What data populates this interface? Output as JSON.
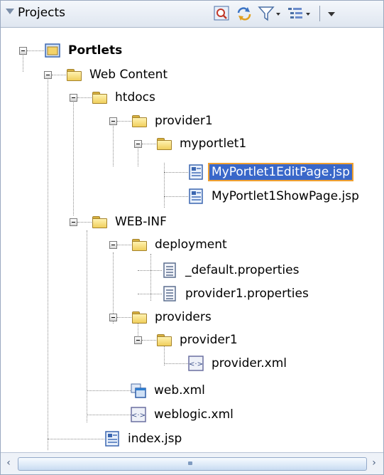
{
  "panel": {
    "title": "Projects"
  },
  "toolbar": {
    "icons": [
      "find-icon",
      "sync-icon",
      "filter-icon",
      "view-options-icon",
      "menu-icon"
    ]
  },
  "tree": {
    "root": "Portlets",
    "web_content": "Web Content",
    "htdocs": "htdocs",
    "provider1_a": "provider1",
    "myportlet1": "myportlet1",
    "edit_page": "MyPortlet1EditPage.jsp",
    "show_page": "MyPortlet1ShowPage.jsp",
    "web_inf": "WEB-INF",
    "deployment": "deployment",
    "default_props": "_default.properties",
    "provider1_props": "provider1.properties",
    "providers": "providers",
    "provider1_b": "provider1",
    "provider_xml": "provider.xml",
    "web_xml": "web.xml",
    "weblogic_xml": "weblogic.xml",
    "index_jsp": "index.jsp",
    "selected": "MyPortlet1EditPage.jsp"
  },
  "scrollbar": {
    "left_arrow": "‹",
    "right_arrow": "›"
  }
}
